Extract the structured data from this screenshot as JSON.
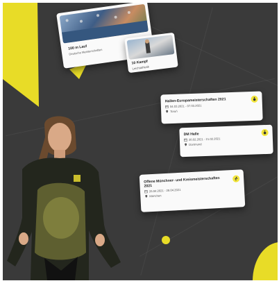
{
  "colors": {
    "background": "#3a3a3a",
    "accent": "#e8dc27",
    "card": "#fafafa"
  },
  "cards": [
    {
      "title": "100 m Lauf",
      "subtitle": "Deutsche Meisterschaften"
    },
    {
      "title": "10 Kampf",
      "subtitle": "Leichtathletik"
    },
    {
      "title": "Hallen-Europameisterschaften 2021",
      "date": "04.03.2021 - 07.03.2021",
      "location": "Toruń",
      "badge_icon": "medal-icon"
    },
    {
      "title": "DM Halle",
      "date": "20.02.2021 - 21.02.2021",
      "location": "Dortmund",
      "badge_icon": "medal-icon"
    },
    {
      "title": "Offene Münchner- und Kreismeisterschaften 2021",
      "date": "26.04.2021 - 28.04.2021",
      "location": "München",
      "badge_icon": "running-icon"
    }
  ]
}
